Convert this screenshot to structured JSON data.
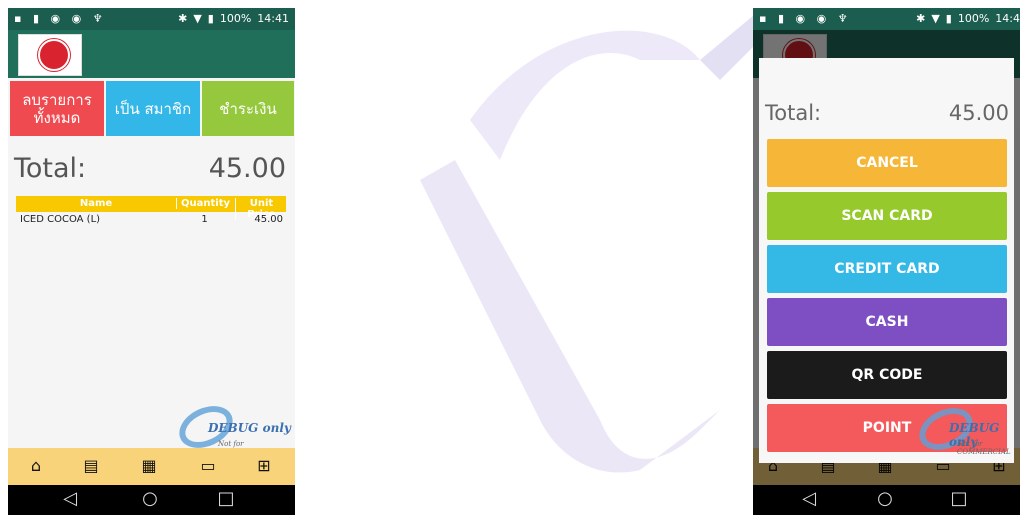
{
  "status_bar": {
    "battery": "100%",
    "time": "14:41",
    "time_right": "14:4"
  },
  "buttons": {
    "clear_all": "ลบรายการ ทั้งหมด",
    "member": "เป็น สมาชิก",
    "pay": "ชำระเงิน"
  },
  "total": {
    "label": "Total:",
    "value": "45.00"
  },
  "table": {
    "headers": [
      "Name",
      "Quantity",
      "Unit Price"
    ],
    "rows": [
      {
        "name": "ICED COCOA (L)",
        "quantity": "1",
        "unit_price": "45.00"
      }
    ]
  },
  "watermark": {
    "main": "DEBUG only",
    "sub": "Not for COMMERCIAL"
  },
  "payment_dialog": {
    "buttons": [
      {
        "label": "CANCEL",
        "color": "#f6b637"
      },
      {
        "label": "SCAN CARD",
        "color": "#95c92c"
      },
      {
        "label": "CREDIT CARD",
        "color": "#34b8e6"
      },
      {
        "label": "CASH",
        "color": "#7e4fc2"
      },
      {
        "label": "QR CODE",
        "color": "#1b1b1b"
      },
      {
        "label": "POINT",
        "color": "#f4595c"
      }
    ]
  },
  "colors": {
    "appbar": "#1f6f5b",
    "nav": "#f9d37a",
    "table_header": "#f8c800"
  },
  "icons": [
    "home-icon",
    "document-icon",
    "chart-icon",
    "display-icon",
    "plus-icon",
    "back-icon",
    "home-circle-icon",
    "recents-icon"
  ]
}
